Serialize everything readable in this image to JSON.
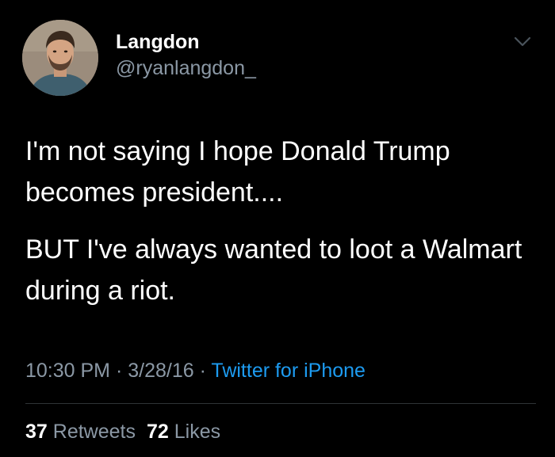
{
  "tweet": {
    "author": {
      "display_name": "Langdon",
      "handle": "@ryanlangdon_"
    },
    "text": [
      "I'm not saying I hope Donald Trump becomes president....",
      "BUT I've always wanted to loot a Walmart during a riot."
    ],
    "meta": {
      "time": "10:30 PM",
      "separator": " · ",
      "date": "3/28/16",
      "source": "Twitter for iPhone"
    },
    "stats": {
      "retweets_count": "37",
      "retweets_label": "Retweets",
      "likes_count": "72",
      "likes_label": "Likes"
    },
    "icons": {
      "menu": "chevron-down-icon"
    },
    "colors": {
      "background": "#000000",
      "text": "#ffffff",
      "secondary": "#8b98a5",
      "link": "#1d9bf0",
      "divider": "#2f3336"
    }
  }
}
